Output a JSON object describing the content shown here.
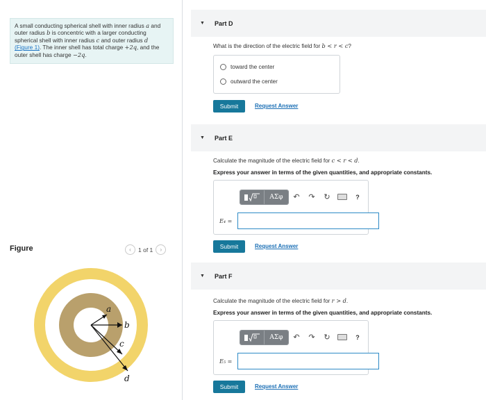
{
  "problem": {
    "text_1": "A small conducting spherical shell with inner radius ",
    "var_a": "a",
    "text_2": " and outer radius ",
    "var_b": "b",
    "text_3": " is concentric with a larger conducting spherical shell with inner radius ",
    "var_c": "c",
    "text_4": " and outer radius ",
    "var_d": "d",
    "link": "(Figure 1)",
    "text_5": ". The inner shell has total charge ",
    "charge_inner": "+2q",
    "text_6": ", and the outer shell has charge ",
    "charge_outer": "−2q",
    "text_7": "."
  },
  "figure_panel": {
    "title": "Figure",
    "pager": "1 of 1",
    "prev_icon": "chevron-left-icon",
    "next_icon": "chevron-right-icon",
    "labels": {
      "a": "a",
      "b": "b",
      "c": "c",
      "d": "d"
    },
    "colors": {
      "outer_shell": "#f2d46a",
      "inner_shell": "#b9a06c",
      "background": "#ffffff"
    }
  },
  "partD": {
    "label": "Part D",
    "question_prefix": "What is the direction of the electric field for ",
    "question_math": "b < r < c",
    "question_suffix": "?",
    "options": [
      "toward the center",
      "outward the center"
    ],
    "submit": "Submit",
    "request": "Request Answer"
  },
  "partE": {
    "label": "Part E",
    "question_prefix": "Calculate the magnitude of the electric field for ",
    "question_math": "c < r < d",
    "question_suffix": ".",
    "instruction": "Express your answer in terms of the given quantities, and appropriate constants.",
    "toolbar_greek": "ΑΣφ",
    "toolbar_help": "?",
    "input_label": "E₄ =",
    "submit": "Submit",
    "request": "Request Answer"
  },
  "partF": {
    "label": "Part F",
    "question_prefix": "Calculate the magnitude of the electric field for ",
    "question_math": "r > d",
    "question_suffix": ".",
    "instruction": "Express your answer in terms of the given quantities, and appropriate constants.",
    "toolbar_greek": "ΑΣφ",
    "toolbar_help": "?",
    "input_label": "E₅ =",
    "submit": "Submit",
    "request": "Request Answer"
  },
  "colors": {
    "accent": "#17789b",
    "link": "#1b6fb5",
    "input_border": "#2d8ac6",
    "problem_bg": "#e7f4f4"
  }
}
